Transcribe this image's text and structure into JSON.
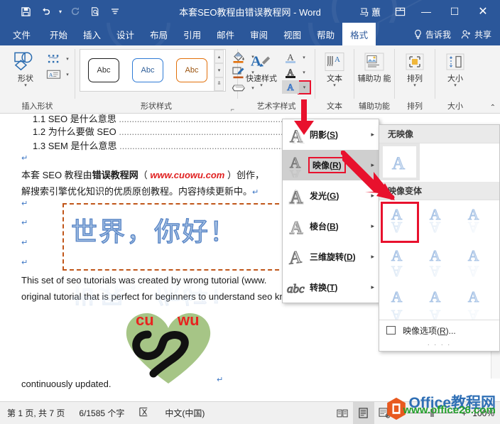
{
  "titlebar": {
    "quick_access": [
      {
        "name": "save-icon",
        "glyph": "⬜"
      },
      {
        "name": "undo-icon",
        "glyph": "↶"
      },
      {
        "name": "redo-icon",
        "glyph": "↻"
      },
      {
        "name": "print-preview-icon",
        "glyph": "⌕"
      },
      {
        "name": "customize-qat-icon",
        "glyph": "☰"
      }
    ],
    "document_title": "本套SEO教程由错误教程网  -  Word",
    "user_name": "马 蕙",
    "ribbon_display_options": "❐",
    "minimize": "—",
    "maximize": "☐",
    "close": "✕"
  },
  "tabs": [
    {
      "label": "文件",
      "active": false
    },
    {
      "label": "开始",
      "active": false
    },
    {
      "label": "插入",
      "active": false
    },
    {
      "label": "设计",
      "active": false
    },
    {
      "label": "布局",
      "active": false
    },
    {
      "label": "引用",
      "active": false
    },
    {
      "label": "邮件",
      "active": false
    },
    {
      "label": "审阅",
      "active": false
    },
    {
      "label": "视图",
      "active": false
    },
    {
      "label": "帮助",
      "active": false
    },
    {
      "label": "格式",
      "active": true
    }
  ],
  "tab_right": {
    "tell_me": "告诉我",
    "tell_me_icon": "Ὂ1",
    "share": "共享"
  },
  "ribbon": {
    "groups": [
      {
        "name": "insert-shapes",
        "label": "插入形状"
      },
      {
        "name": "shape-styles",
        "label": "形状样式"
      },
      {
        "name": "wordart-styles",
        "label": "艺术字样式"
      },
      {
        "name": "text",
        "label": "文本"
      },
      {
        "name": "accessibility",
        "label": "辅助功能"
      },
      {
        "name": "arrange",
        "label": "排列"
      },
      {
        "name": "size",
        "label": "大小"
      }
    ],
    "shapes_button": "形状",
    "shape_thumbs": [
      {
        "label": "Abc",
        "outline": "#1d1d1d",
        "text": "#333333"
      },
      {
        "label": "Abc",
        "outline": "#2f7bd6",
        "text": "#2f5f99"
      },
      {
        "label": "Abc",
        "outline": "#e2700a",
        "text": "#9c5510"
      }
    ],
    "quick_styles": "快速样式",
    "text_button": "文本",
    "accessibility_button": "辅助功 能",
    "arrange_button": "排列",
    "size_button": "大小",
    "collapse_ribbon_icon": "⌃"
  },
  "document": {
    "toc": [
      {
        "num": "1.1",
        "text": "SEO 是什么意思"
      },
      {
        "num": "1.2",
        "text": "为什么要做 SEO"
      },
      {
        "num": "1.3",
        "text": "SEM 是什么意思"
      }
    ],
    "para_cn_1a": "本套 SEO 教程由",
    "para_cn_1b": "错误教程网",
    "para_cn_1c": "（",
    "para_link": "www.cuowu.com",
    "para_cn_1d": "）创作，",
    "para_cn_2": "解搜索引擎优化知识的优质原创教程。内容持续更新中。",
    "wordart_text": "世界，你好！",
    "para_en_1": "This set of seo tutorials was created by wrong tutorial (www.",
    "para_en_2": "original tutorial that is perfect for beginners to understand seo knowledge. The con",
    "para_en_3": "continuously updated.",
    "pilcrow": "↵",
    "logo_text_left": "cu",
    "logo_text_right": "wu"
  },
  "effects_menu": {
    "items": [
      {
        "name": "shadow",
        "label_pre": "阴影(",
        "label_key": "S",
        "label_post": ")",
        "selected": false,
        "highlight": false
      },
      {
        "name": "reflection",
        "label_pre": "映像(",
        "label_key": "R",
        "label_post": ")",
        "selected": true,
        "highlight": true
      },
      {
        "name": "glow",
        "label_pre": "发光(",
        "label_key": "G",
        "label_post": ")",
        "selected": false,
        "highlight": false
      },
      {
        "name": "bevel",
        "label_pre": "棱台(",
        "label_key": "B",
        "label_post": ")",
        "selected": false,
        "highlight": false
      },
      {
        "name": "three-d-rotation",
        "label_pre": "三维旋转(",
        "label_key": "D",
        "label_post": ")",
        "selected": false,
        "highlight": false
      },
      {
        "name": "transform",
        "label_pre": "转换(",
        "label_key": "T",
        "label_post": ")",
        "selected": false,
        "highlight": false
      }
    ],
    "arrow": "▸"
  },
  "reflection_submenu": {
    "no_reflection_header": "无映像",
    "variations_header": "映像变体",
    "variation_count": 9,
    "selected_variation_index": 0,
    "options_label_pre": "映像选项(",
    "options_label_key": "R",
    "options_label_post": ")...",
    "footer_dots": "· · · ·"
  },
  "statusbar": {
    "page_info": "第 1 页, 共 7 页",
    "word_count": "6/1585 个字",
    "proofing_icon": "⌧",
    "language": "中文(中国)",
    "view_buttons": [
      {
        "name": "read-mode",
        "glyph": "☷"
      },
      {
        "name": "print-layout",
        "glyph": "▤",
        "active": true
      },
      {
        "name": "web-layout",
        "glyph": "☰"
      }
    ],
    "zoom_out": "−",
    "zoom_in": "+",
    "zoom_level": "100%"
  },
  "watermark": {
    "cn": "Office教程网",
    "en": "www.office26.com"
  },
  "colors": {
    "ribbon_blue": "#2b579a",
    "accent_red": "#e8112d",
    "link_red": "#e02020",
    "wordart_blue": "#aac4e4",
    "wordart_stroke": "#5b87c7",
    "shape_border_orange": "#c0561a",
    "heart_green": "#a6c586",
    "logo_red": "#e8231f"
  }
}
